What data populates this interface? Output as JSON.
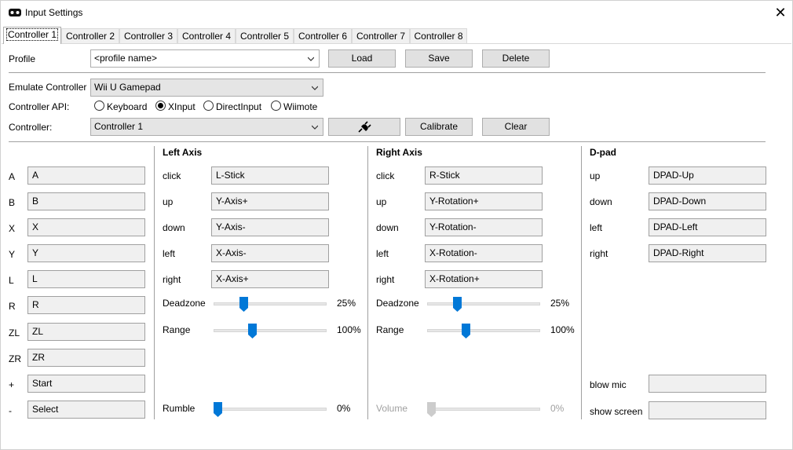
{
  "window": {
    "title": "Input Settings",
    "close": "✕",
    "icon": "gamepad-icon"
  },
  "tabs": [
    "Controller 1",
    "Controller 2",
    "Controller 3",
    "Controller 4",
    "Controller 5",
    "Controller 6",
    "Controller 7",
    "Controller 8"
  ],
  "profile": {
    "label": "Profile",
    "value": "<profile name>",
    "load": "Load",
    "save": "Save",
    "delete": "Delete"
  },
  "emulate": {
    "label": "Emulate Controller",
    "value": "Wii U Gamepad"
  },
  "api": {
    "label": "Controller API:",
    "options": [
      "Keyboard",
      "XInput",
      "DirectInput",
      "Wiimote"
    ],
    "selected": "XInput"
  },
  "controller": {
    "label": "Controller:",
    "value": "Controller 1",
    "connect_icon": "plug-icon",
    "calibrate": "Calibrate",
    "clear": "Clear"
  },
  "buttons": [
    {
      "label": "A",
      "value": "A"
    },
    {
      "label": "B",
      "value": "B"
    },
    {
      "label": "X",
      "value": "X"
    },
    {
      "label": "Y",
      "value": "Y"
    },
    {
      "label": "L",
      "value": "L"
    },
    {
      "label": "R",
      "value": "R"
    },
    {
      "label": "ZL",
      "value": "ZL"
    },
    {
      "label": "ZR",
      "value": "ZR"
    },
    {
      "label": "+",
      "value": "Start"
    },
    {
      "label": "-",
      "value": "Select"
    }
  ],
  "left_axis": {
    "title": "Left Axis",
    "rows": [
      {
        "label": "click",
        "value": "L-Stick"
      },
      {
        "label": "up",
        "value": "Y-Axis+"
      },
      {
        "label": "down",
        "value": "Y-Axis-"
      },
      {
        "label": "left",
        "value": "X-Axis-"
      },
      {
        "label": "right",
        "value": "X-Axis+"
      }
    ],
    "deadzone": {
      "label": "Deadzone",
      "value": "25%",
      "level": 0.25
    },
    "range": {
      "label": "Range",
      "value": "100%",
      "level": 0.333
    },
    "rumble": {
      "label": "Rumble",
      "value": "0%",
      "level": 0
    }
  },
  "right_axis": {
    "title": "Right Axis",
    "rows": [
      {
        "label": "click",
        "value": "R-Stick"
      },
      {
        "label": "up",
        "value": "Y-Rotation+"
      },
      {
        "label": "down",
        "value": "Y-Rotation-"
      },
      {
        "label": "left",
        "value": "X-Rotation-"
      },
      {
        "label": "right",
        "value": "X-Rotation+"
      }
    ],
    "deadzone": {
      "label": "Deadzone",
      "value": "25%",
      "level": 0.25
    },
    "range": {
      "label": "Range",
      "value": "100%",
      "level": 0.333
    },
    "volume": {
      "label": "Volume",
      "value": "0%",
      "level": 0
    }
  },
  "dpad": {
    "title": "D-pad",
    "rows": [
      {
        "label": "up",
        "value": "DPAD-Up"
      },
      {
        "label": "down",
        "value": "DPAD-Down"
      },
      {
        "label": "left",
        "value": "DPAD-Left"
      },
      {
        "label": "right",
        "value": "DPAD-Right"
      }
    ],
    "extra": [
      {
        "label": "blow mic",
        "value": ""
      },
      {
        "label": "show screen",
        "value": ""
      }
    ]
  },
  "colors": {
    "accent": "#0078d7",
    "disabled": "#cccccc"
  }
}
